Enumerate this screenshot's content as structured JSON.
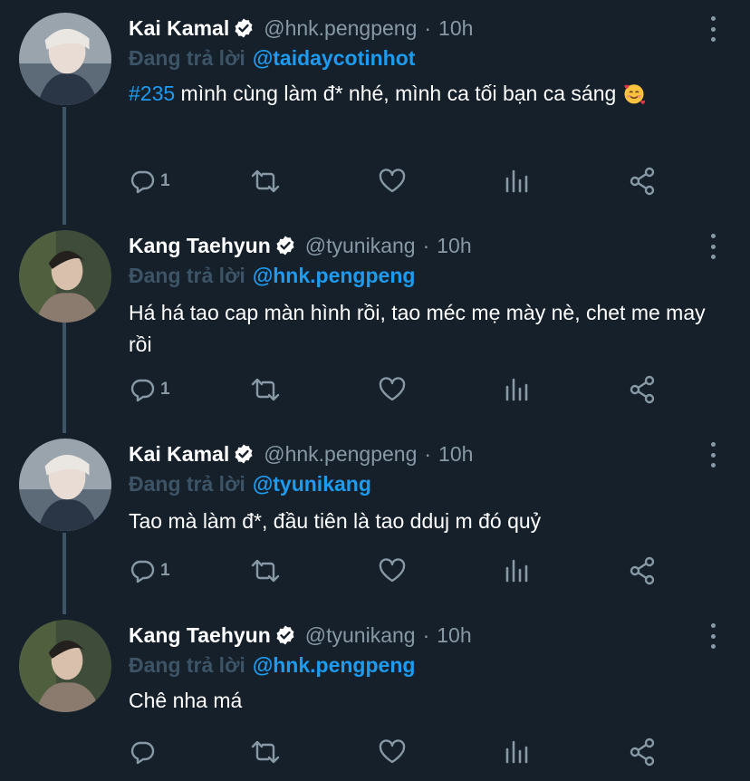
{
  "thread": {
    "tweets": [
      {
        "name": "Kai Kamal",
        "handle": "@hnk.pengpeng",
        "time": "10h",
        "replying_label": "Đang trả lời",
        "replying_to": "@taidaycotinhot",
        "hashtag": "#235",
        "text": " mình cùng làm đ* nhé, mình ca tối bạn ca sáng ",
        "emoji": "smiling-face-with-hearts-icon",
        "reply_count": "1"
      },
      {
        "name": "Kang Taehyun",
        "handle": "@tyunikang",
        "time": "10h",
        "replying_label": "Đang trả lời",
        "replying_to": "@hnk.pengpeng",
        "text": "Há há tao cap màn hình rồi, tao méc mẹ mày nè, chet me may rồi",
        "reply_count": "1"
      },
      {
        "name": "Kai Kamal",
        "handle": "@hnk.pengpeng",
        "time": "10h",
        "replying_label": "Đang trả lời",
        "replying_to": "@tyunikang",
        "text": "Tao mà làm đ*, đầu tiên là tao dduj m đó quỷ",
        "reply_count": "1"
      },
      {
        "name": "Kang Taehyun",
        "handle": "@tyunikang",
        "time": "10h",
        "replying_label": "Đang trả lời",
        "replying_to": "@hnk.pengpeng",
        "text": "Chê nha má",
        "reply_count": ""
      }
    ],
    "separator": "·"
  },
  "colors": {
    "background": "#15202b",
    "primary_text": "#ffffff",
    "secondary_text": "#8899a6",
    "replying_label": "#3d5466",
    "link": "#1d9bf0",
    "verified_badge": "#ffffff"
  }
}
